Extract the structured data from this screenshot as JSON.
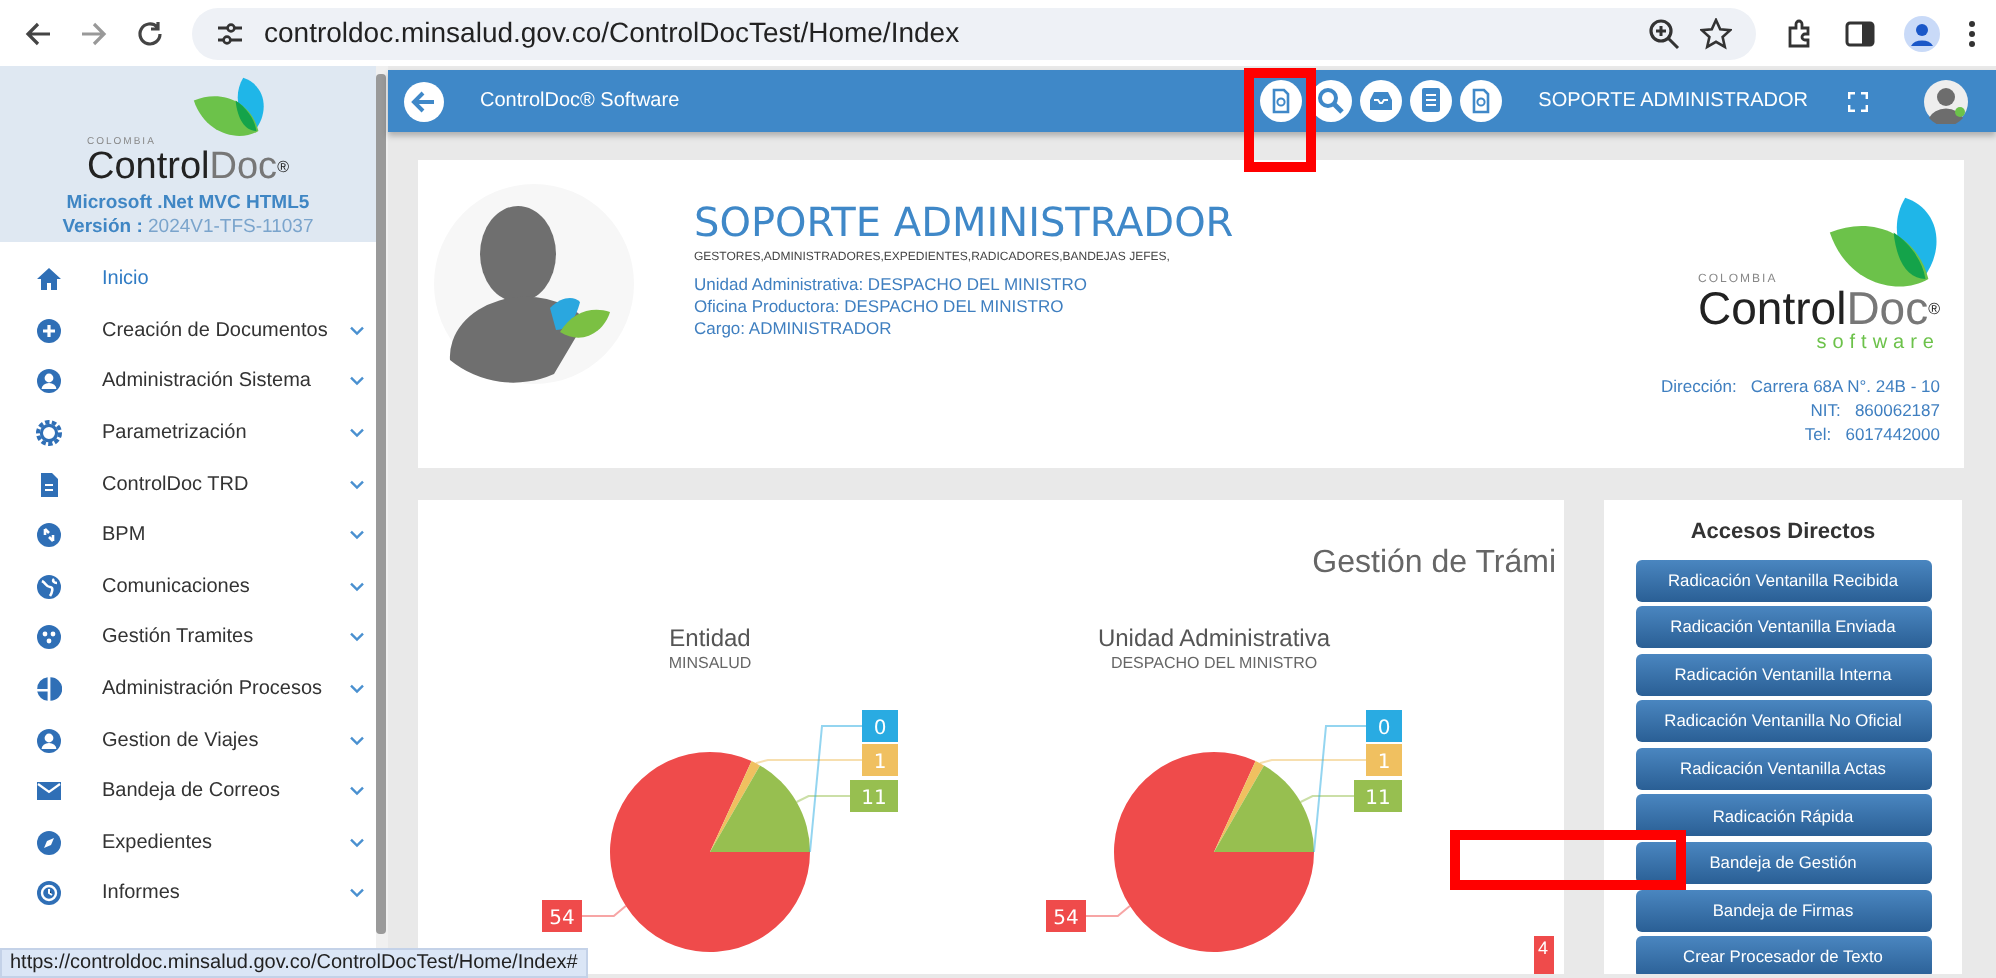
{
  "browser": {
    "url": "controldoc.minsalud.gov.co/ControlDocTest/Home/Index"
  },
  "sidebar": {
    "logo_country": "COLOMBIA",
    "logo_name_dark": "Control",
    "logo_name_light": "Doc",
    "logo_mark": "®",
    "platform": "Microsoft .Net MVC HTML5",
    "version_label": "Versión :",
    "version": "2024V1-TFS-11037",
    "items": [
      {
        "label": "Inicio",
        "kind": "home",
        "selected": true,
        "expandable": false
      },
      {
        "label": "Creación de Documentos",
        "kind": "plus",
        "selected": false,
        "expandable": true
      },
      {
        "label": "Administración Sistema",
        "kind": "user",
        "selected": false,
        "expandable": true
      },
      {
        "label": "Parametrización",
        "kind": "gear",
        "selected": false,
        "expandable": true
      },
      {
        "label": "ControlDoc TRD",
        "kind": "file",
        "selected": false,
        "expandable": true
      },
      {
        "label": "BPM",
        "kind": "sync",
        "selected": false,
        "expandable": true
      },
      {
        "label": "Comunicaciones",
        "kind": "globe",
        "selected": false,
        "expandable": true
      },
      {
        "label": "Gestión Tramites",
        "kind": "dots",
        "selected": false,
        "expandable": true
      },
      {
        "label": "Administración Procesos",
        "kind": "pie",
        "selected": false,
        "expandable": true
      },
      {
        "label": "Gestion de Viajes",
        "kind": "user",
        "selected": false,
        "expandable": true
      },
      {
        "label": "Bandeja de Correos",
        "kind": "mail",
        "selected": false,
        "expandable": true
      },
      {
        "label": "Expedientes",
        "kind": "compass",
        "selected": false,
        "expandable": true
      },
      {
        "label": "Informes",
        "kind": "clock",
        "selected": false,
        "expandable": true
      }
    ]
  },
  "topbar": {
    "title": "ControlDoc® Software",
    "user": "SOPORTE ADMINISTRADOR",
    "icons": [
      {
        "kind": "docsearch",
        "highlighted": true
      },
      {
        "kind": "search",
        "highlighted": false
      },
      {
        "kind": "inbox",
        "highlighted": false
      },
      {
        "kind": "list",
        "highlighted": false
      },
      {
        "kind": "docsearch",
        "highlighted": false
      }
    ]
  },
  "profile": {
    "name": "SOPORTE ADMINISTRADOR",
    "roles": "GESTORES,ADMINISTRADORES,EXPEDIENTES,RADICADORES,BANDEJAS JEFES,",
    "lines": [
      "Unidad Administrativa: DESPACHO DEL MINISTRO",
      "Oficina Productora: DESPACHO DEL MINISTRO",
      "Cargo: ADMINISTRADOR"
    ],
    "company_logo": {
      "country": "COLOMBIA",
      "name_dark": "Control",
      "name_light": "Doc",
      "mark": "®",
      "tagline": "software"
    },
    "contact": [
      {
        "label": "Dirección:",
        "value": "Carrera 68A N°. 24B - 10"
      },
      {
        "label": "NIT:",
        "value": "860062187"
      },
      {
        "label": "Tel:",
        "value": "6017442000"
      }
    ]
  },
  "charts_section": {
    "title": "Gestión de Trámi",
    "charts": [
      {
        "title": "Entidad",
        "subtitle": "MINSALUD",
        "chart_data": {
          "type": "pie",
          "values": [
            54,
            1,
            11,
            0
          ],
          "value_labels": [
            "54",
            "1",
            "11",
            "0"
          ]
        }
      },
      {
        "title": "Unidad Administrativa",
        "subtitle": "DESPACHO DEL MINISTRO",
        "chart_data": {
          "type": "pie",
          "values": [
            54,
            1,
            11,
            0
          ],
          "value_labels": [
            "54",
            "1",
            "11",
            "0"
          ]
        }
      }
    ],
    "cut_chart_label": "4"
  },
  "shortcuts": {
    "title": "Accesos Directos",
    "buttons": [
      {
        "label": "Radicación Ventanilla Recibida",
        "highlighted": false
      },
      {
        "label": "Radicación Ventanilla Enviada",
        "highlighted": false
      },
      {
        "label": "Radicación Ventanilla Interna",
        "highlighted": false
      },
      {
        "label": "Radicación Ventanilla No Oficial",
        "highlighted": false
      },
      {
        "label": "Radicación Ventanilla Actas",
        "highlighted": false
      },
      {
        "label": "Radicación Rápida",
        "highlighted": false
      },
      {
        "label": "Bandeja de Gestión",
        "highlighted": true
      },
      {
        "label": "Bandeja de Firmas",
        "highlighted": false
      },
      {
        "label": "Crear Procesador de Texto",
        "highlighted": false
      }
    ]
  },
  "status_url": "https://controldoc.minsalud.gov.co/ControlDocTest/Home/Index#"
}
